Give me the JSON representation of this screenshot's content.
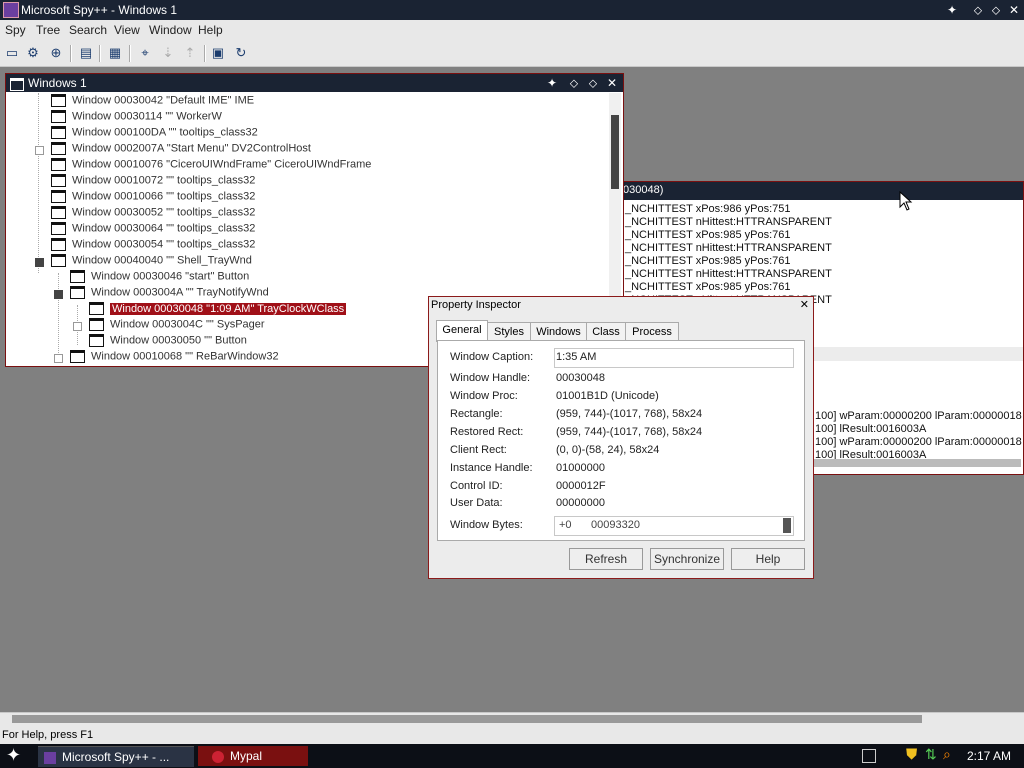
{
  "app": {
    "title": "Microsoft Spy++ - Windows 1"
  },
  "menu": [
    "Spy",
    "Tree",
    "Search",
    "View",
    "Window",
    "Help"
  ],
  "toolbar": {
    "icons": [
      "windows-icon",
      "processes-icon",
      "threads-icon",
      "messages-icon",
      "log-messages-icon",
      "find-window-icon",
      "find-next-icon",
      "find-prev-icon",
      "properties-icon",
      "refresh-icon"
    ]
  },
  "windows_pane": {
    "title": "Windows 1",
    "items": [
      {
        "text": "Window 00030042 \"Default IME\" IME",
        "depth": 1
      },
      {
        "text": "Window 00030114 \"\" WorkerW",
        "depth": 1
      },
      {
        "text": "Window 000100DA \"\" tooltips_class32",
        "depth": 1
      },
      {
        "text": "Window 0002007A \"Start Menu\" DV2ControlHost",
        "depth": 1
      },
      {
        "text": "Window 00010076 \"CiceroUIWndFrame\" CiceroUIWndFrame",
        "depth": 1
      },
      {
        "text": "Window 00010072 \"\" tooltips_class32",
        "depth": 1
      },
      {
        "text": "Window 00010066 \"\" tooltips_class32",
        "depth": 1
      },
      {
        "text": "Window 00030052 \"\" tooltips_class32",
        "depth": 1
      },
      {
        "text": "Window 00030064 \"\" tooltips_class32",
        "depth": 1
      },
      {
        "text": "Window 00030054 \"\" tooltips_class32",
        "depth": 1
      },
      {
        "text": "Window 00040040 \"\" Shell_TrayWnd",
        "depth": 1
      },
      {
        "text": "Window 00030046 \"start\" Button",
        "depth": 2
      },
      {
        "text": "Window 0003004A \"\" TrayNotifyWnd",
        "depth": 2
      },
      {
        "text": "Window 00030048 \"1:09 AM\" TrayClockWClass",
        "depth": 3
      },
      {
        "text": "Window 0003004C \"\" SysPager",
        "depth": 3
      },
      {
        "text": "Window 00030050 \"\" Button",
        "depth": 3
      },
      {
        "text": "Window 00010068 \"\" ReBarWindow32",
        "depth": 2
      }
    ]
  },
  "messages_pane": {
    "title": "030048)",
    "lines": [
      "_NCHITTEST xPos:986 yPos:751",
      "_NCHITTEST nHittest:HTTRANSPARENT",
      "_NCHITTEST xPos:985 yPos:761",
      "_NCHITTEST nHittest:HTTRANSPARENT",
      "_NCHITTEST xPos:985 yPos:761",
      "_NCHITTEST nHittest:HTTRANSPARENT",
      "_NCHITTEST xPos:985 yPos:761",
      "_NCHITTEST nHittest:HTTRANSPARENT",
      "_NCHITTEST xPos:985 yPos:761"
    ],
    "lines_bottom": [
      "100] wParam:00000200 lParam:00000018",
      "100] lResult:0016003A",
      "100] wParam:00000200 lParam:00000018",
      "100] lResult:0016003A"
    ]
  },
  "property_inspector": {
    "title": "Property Inspector",
    "tabs": [
      "General",
      "Styles",
      "Windows",
      "Class",
      "Process"
    ],
    "active_tab": "General",
    "rows": [
      {
        "label": "Window Caption:",
        "value": "1:35 AM"
      },
      {
        "label": "Window Handle:",
        "value": "00030048"
      },
      {
        "label": "Window Proc:",
        "value": "01001B1D (Unicode)"
      },
      {
        "label": "Rectangle:",
        "value": "(959, 744)-(1017, 768), 58x24"
      },
      {
        "label": "Restored Rect:",
        "value": "(959, 744)-(1017, 768), 58x24"
      },
      {
        "label": "Client Rect:",
        "value": "(0, 0)-(58, 24), 58x24"
      },
      {
        "label": "Instance Handle:",
        "value": "01000000"
      },
      {
        "label": "Control ID:",
        "value": "0000012F"
      },
      {
        "label": "User Data:",
        "value": "00000000"
      }
    ],
    "window_bytes": {
      "label": "Window Bytes:",
      "offset": "+0",
      "value": "00093320"
    },
    "buttons": {
      "refresh": "Refresh",
      "synchronize": "Synchronize",
      "help": "Help"
    }
  },
  "status": {
    "text": "For Help, press F1"
  },
  "taskbar": {
    "items": [
      {
        "label": "Microsoft Spy++ - ...",
        "active": true
      },
      {
        "label": "Mypal",
        "active": false
      }
    ],
    "clock": "2:17 AM"
  },
  "colors": {
    "titlebar": "#1a2333",
    "selection": "#a01018",
    "mdi_background": "#808080"
  }
}
